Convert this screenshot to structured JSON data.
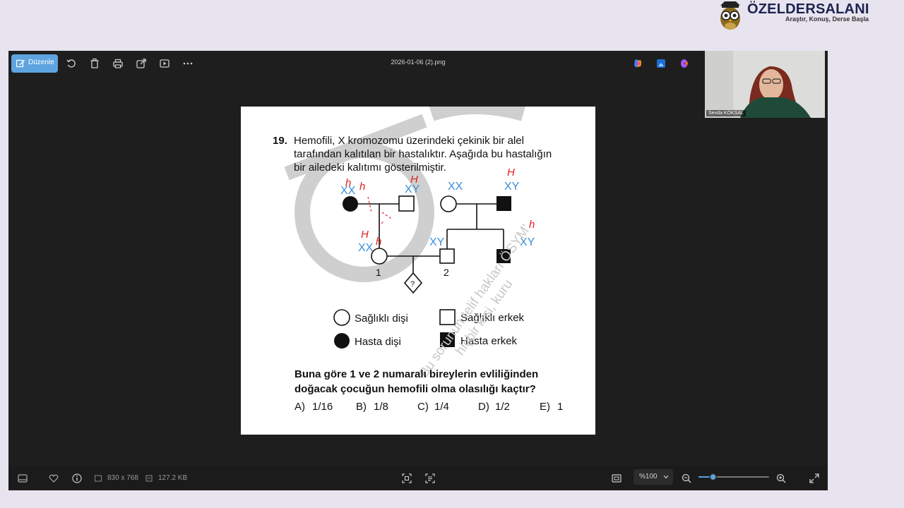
{
  "brand": {
    "name": "ÖZELDERSALANI",
    "slogan": "Araştır, Konuş, Derse Başla"
  },
  "toolbar": {
    "edit_label": "Düzenle",
    "file_title": "2026-01-06 (2).png"
  },
  "webcam": {
    "participant_name": "Sevda KÖKSAL"
  },
  "question": {
    "number": "19.",
    "text_lines": [
      "Hemofili, X kromozomu üzerindeki çekinik bir alel",
      "tarafından kalıtılan bir hastalıktır. Aşağıda bu hastalığın",
      "bir ailedeki kalıtımı gösterilmiştir."
    ],
    "individual_labels": [
      "1",
      "2"
    ],
    "unknown_label": "?",
    "genotype_annotations": [
      "XX",
      "XY",
      "XX",
      "XY",
      "XX",
      "XY",
      "XY"
    ],
    "handwriting": [
      "h",
      "h",
      "H",
      "H",
      "H",
      "h",
      "h"
    ],
    "legend": {
      "healthy_female": "Sağlıklı dişi",
      "healthy_male": "Sağlıklı erkek",
      "sick_female": "Hasta dişi",
      "sick_male": "Hasta erkek"
    },
    "prompt_lines": [
      "Buna göre 1 ve 2 numaralı bireylerin evliliğinden",
      "doğacak çocuğun hemofili olma olasılığı kaçtır?"
    ],
    "options": [
      {
        "letter": "A)",
        "value": "1/16"
      },
      {
        "letter": "B)",
        "value": "1/8"
      },
      {
        "letter": "C)",
        "value": "1/4"
      },
      {
        "letter": "D)",
        "value": "1/2"
      },
      {
        "letter": "E)",
        "value": "1"
      }
    ],
    "watermark_lines": [
      "Bu sorunun telif hakları ÖSYM'",
      "hiçbir kişi, kuru"
    ]
  },
  "status": {
    "dimensions": "830 x 768",
    "file_size": "127.2 KB",
    "zoom": "%100",
    "zoom_level": 0.18
  },
  "colors": {
    "accent": "#5ea4e0",
    "annotation_blue": "#3a8fd6",
    "annotation_red": "#e02020"
  }
}
